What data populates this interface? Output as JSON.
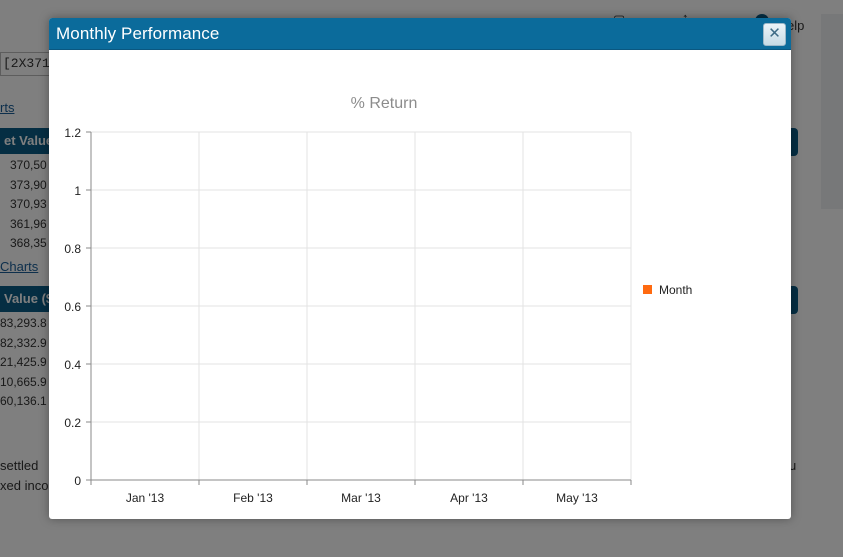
{
  "background": {
    "account_field": "[2X371",
    "link_charts_1": "rts",
    "link_charts_2": "Charts",
    "table1_header": "et Value",
    "table1_values": [
      "370,50",
      "373,90",
      "370,93",
      "361,96",
      "368,35"
    ],
    "table2_header": "Value ($",
    "table2_values": [
      "83,293.8",
      "82,332.9",
      "21,425.9",
      "10,665.9",
      "60,136.1"
    ],
    "footer_line1": "settled",
    "footer_line2": "xed inco",
    "help_label": "elp",
    "right_u": "u"
  },
  "dialog": {
    "title": "Monthly Performance",
    "close_glyph": "✕"
  },
  "chart_data": {
    "type": "bar",
    "title": "% Return",
    "categories": [
      "Jan '13",
      "Feb '13",
      "Mar '13",
      "Apr '13",
      "May '13"
    ],
    "series": [
      {
        "name": "Month",
        "values": [
          null,
          null,
          null,
          null,
          null
        ],
        "color": "#ff6a10"
      }
    ],
    "ylim": [
      0,
      1.2
    ],
    "yticks": [
      "0",
      "0.2",
      "0.4",
      "0.6",
      "0.8",
      "1",
      "1.2"
    ],
    "xlabel": "",
    "ylabel": "",
    "grid": true,
    "legend": "right"
  },
  "colors": {
    "titlebar": "#0b6b9b",
    "header_bg": "#0b5d86",
    "grid": "#e3e3e3",
    "axis": "#8a8a8a",
    "chart_title": "#8c8c8c"
  }
}
